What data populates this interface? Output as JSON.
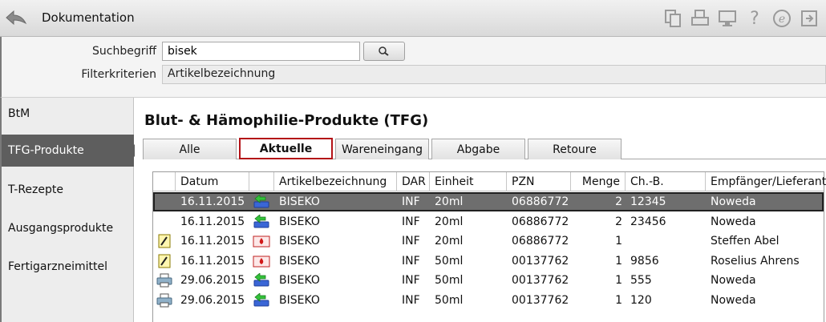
{
  "window": {
    "title": "Dokumentation"
  },
  "toolbar_icons": [
    "documents-icon",
    "printer-icon",
    "monitor-icon",
    "help-icon",
    "euro-icon",
    "exit-icon"
  ],
  "toolbar_help": "?",
  "search": {
    "label": "Suchbegriff",
    "value": "bisek",
    "filter_label": "Filterkriterien",
    "filter_value": "Artikelbezeichnung"
  },
  "sidebar": {
    "items": [
      {
        "label": "BtM",
        "active": false
      },
      {
        "label": "TFG-Produkte",
        "active": true
      },
      {
        "label": "T-Rezepte",
        "active": false
      },
      {
        "label": "Ausgangsprodukte",
        "active": false
      },
      {
        "label": "Fertigarzneimittel",
        "active": false
      }
    ]
  },
  "main": {
    "heading": "Blut- & Hämophilie-Produkte (TFG)",
    "tabs": [
      {
        "label": "Alle",
        "active": false
      },
      {
        "label": "Aktuelle",
        "active": true
      },
      {
        "label": "Wareneingang",
        "active": false
      },
      {
        "label": "Abgabe",
        "active": false
      },
      {
        "label": "Retoure",
        "active": false
      }
    ]
  },
  "table": {
    "columns": [
      "",
      "Datum",
      "",
      "Artikelbezeichnung",
      "DAR",
      "Einheit",
      "PZN",
      "Menge",
      "Ch.-B.",
      "Empfänger/Lieferant"
    ],
    "rows": [
      {
        "type_icon": "",
        "datum": "16.11.2015",
        "dir_icon": "incoming-arrow-icon",
        "artikel": "BISEKO",
        "dar": "INF",
        "einheit": "20ml",
        "pzn": "06886772",
        "menge": "2",
        "charge": "12345",
        "partner": "Noweda",
        "selected": true
      },
      {
        "type_icon": "",
        "datum": "16.11.2015",
        "dir_icon": "incoming-arrow-icon",
        "artikel": "BISEKO",
        "dar": "INF",
        "einheit": "20ml",
        "pzn": "06886772",
        "menge": "2",
        "charge": "23456",
        "partner": "Noweda",
        "selected": false
      },
      {
        "type_icon": "edit-note-icon",
        "datum": "16.11.2015",
        "dir_icon": "blood-drop-icon",
        "artikel": "BISEKO",
        "dar": "INF",
        "einheit": "20ml",
        "pzn": "06886772",
        "menge": "1",
        "charge": "",
        "partner": "Steffen Abel",
        "selected": false
      },
      {
        "type_icon": "edit-note-icon",
        "datum": "16.11.2015",
        "dir_icon": "blood-drop-icon",
        "artikel": "BISEKO",
        "dar": "INF",
        "einheit": "50ml",
        "pzn": "00137762",
        "menge": "1",
        "charge": "9856",
        "partner": "Roselius Ahrens",
        "selected": false
      },
      {
        "type_icon": "printer-icon",
        "datum": "29.06.2015",
        "dir_icon": "incoming-arrow-icon",
        "artikel": "BISEKO",
        "dar": "INF",
        "einheit": "50ml",
        "pzn": "00137762",
        "menge": "1",
        "charge": "555",
        "partner": "Noweda",
        "selected": false
      },
      {
        "type_icon": "printer-icon",
        "datum": "29.06.2015",
        "dir_icon": "incoming-arrow-icon",
        "artikel": "BISEKO",
        "dar": "INF",
        "einheit": "50ml",
        "pzn": "00137762",
        "menge": "1",
        "charge": "120",
        "partner": "Noweda",
        "selected": false
      }
    ]
  },
  "colors": {
    "selected_row": "#6e6e6e",
    "active_tab_border": "#b31217",
    "sidebar_active": "#5e5e5e"
  }
}
